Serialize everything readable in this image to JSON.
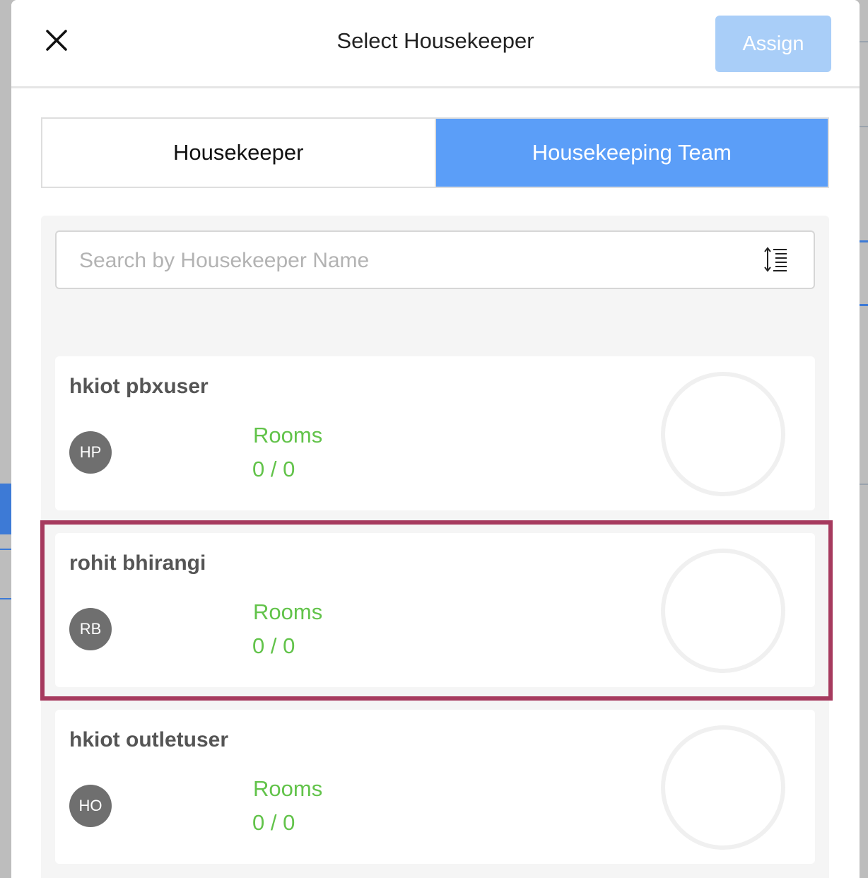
{
  "modal": {
    "title": "Select Housekeeper",
    "assign_label": "Assign"
  },
  "tabs": [
    {
      "label": "Housekeeper",
      "active": false
    },
    {
      "label": "Housekeeping Team",
      "active": true
    }
  ],
  "search": {
    "placeholder": "Search by Housekeeper Name",
    "value": ""
  },
  "housekeepers": [
    {
      "name": "hkiot pbxuser",
      "initials": "HP",
      "rooms_label": "Rooms",
      "rooms": "0 / 0",
      "progress": 0
    },
    {
      "name": "rohit bhirangi",
      "initials": "RB",
      "rooms_label": "Rooms",
      "rooms": "0 / 0",
      "progress": 0,
      "highlighted": true
    },
    {
      "name": "hkiot outletuser",
      "initials": "HO",
      "rooms_label": "Rooms",
      "rooms": "0 / 0",
      "progress": 0
    }
  ],
  "colors": {
    "accent": "#5b9ef8",
    "assign_disabled": "#a9cef8",
    "rooms_text": "#62c34a",
    "highlight_border": "#a63a5e",
    "avatar_bg": "#6f6f6f"
  },
  "icons": {
    "close": "close-icon",
    "sort": "sort-icon",
    "progress": "progress-ring-icon"
  }
}
